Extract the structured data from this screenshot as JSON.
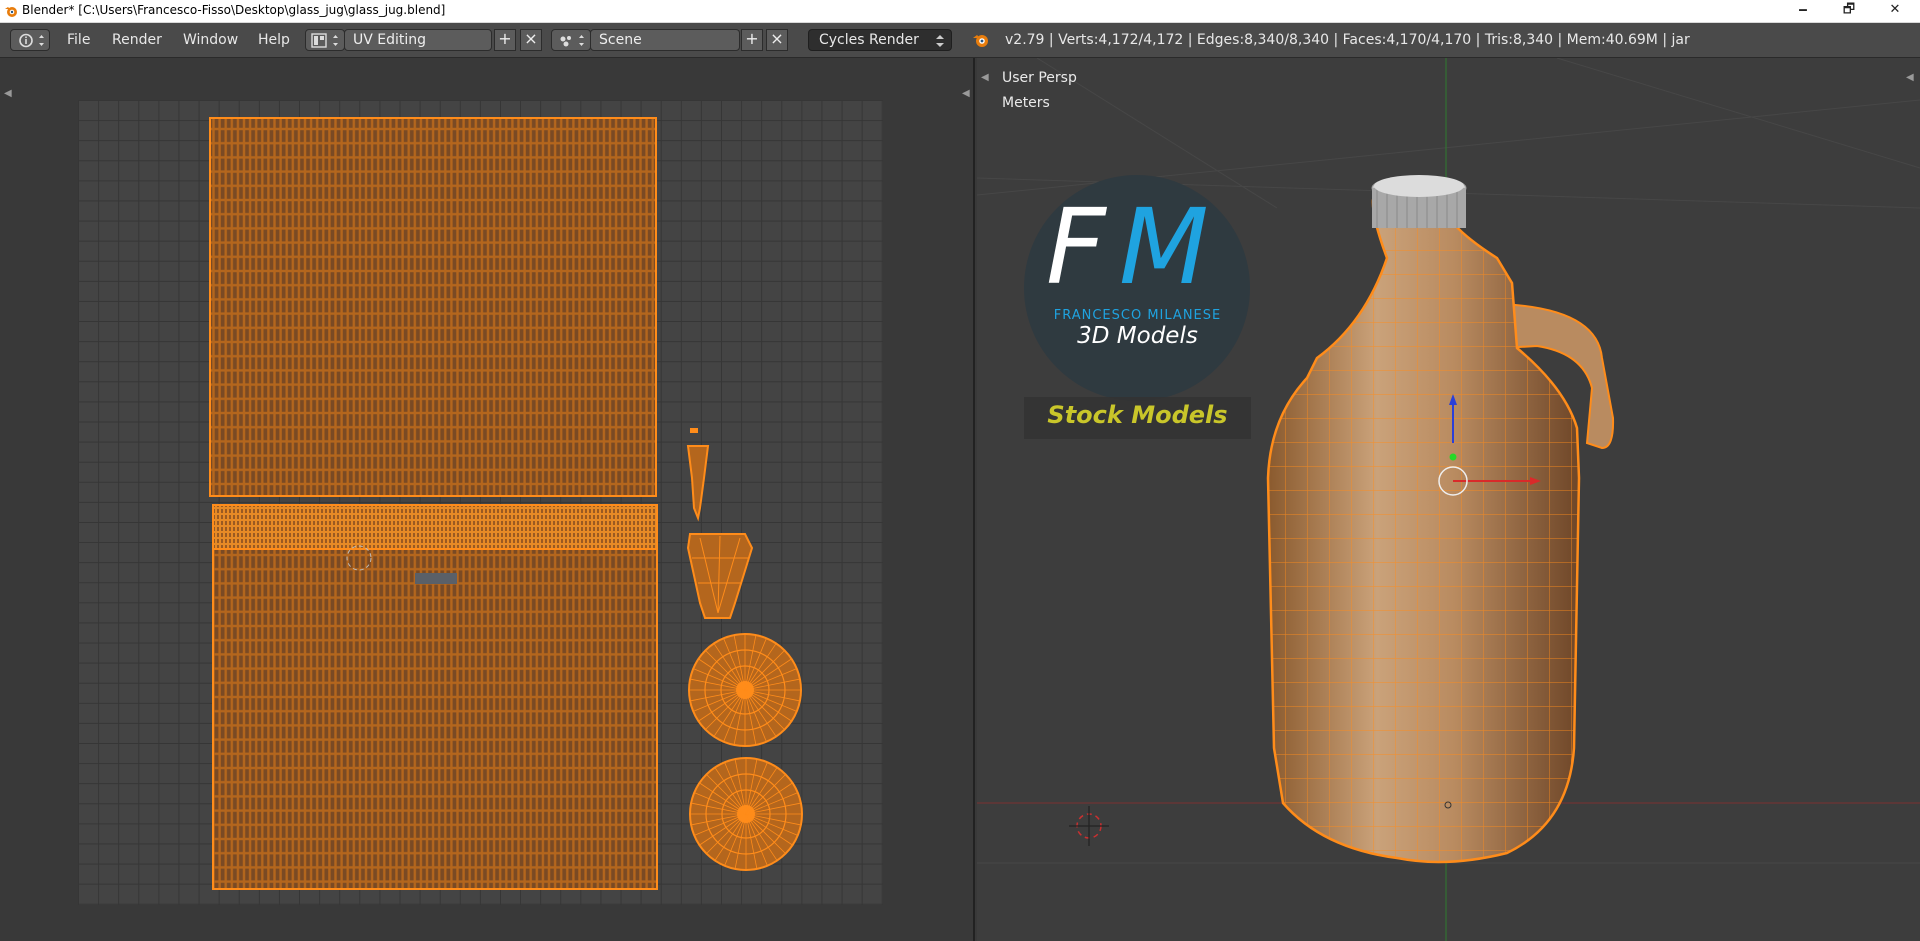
{
  "window": {
    "title": "Blender* [C:\\Users\\Francesco-Fisso\\Desktop\\glass_jug\\glass_jug.blend]",
    "min_label": "🗕",
    "restore_label": "🗗",
    "close_label": "✕"
  },
  "menu": {
    "file": "File",
    "render": "Render",
    "window": "Window",
    "help": "Help"
  },
  "header": {
    "layout": "UV Editing",
    "scene": "Scene",
    "engine": "Cycles Render",
    "stats": "v2.79 | Verts:4,172/4,172 | Edges:8,340/8,340 | Faces:4,170/4,170 | Tris:8,340 | Mem:40.69M | jar",
    "add_label": "+",
    "remove_label": "×"
  },
  "viewport": {
    "view_label": "User Persp",
    "units_label": "Meters"
  },
  "watermark": {
    "monogram_f": "F",
    "monogram_m": "M",
    "author": "FRANCESCO MILANESE",
    "subtitle": "3D Models",
    "banner": "Stock Models"
  },
  "colors": {
    "accent_orange": "#ff8c1a",
    "panel_bg": "#393939",
    "header_bg": "#4a4a4a",
    "brand_blue": "#1fa3e0",
    "banner_yellow": "#c9c62a"
  },
  "icons": {
    "info": "info-icon",
    "layout": "screen-layout-icon",
    "scene": "scene-icon",
    "blender": "blender-logo-icon"
  }
}
